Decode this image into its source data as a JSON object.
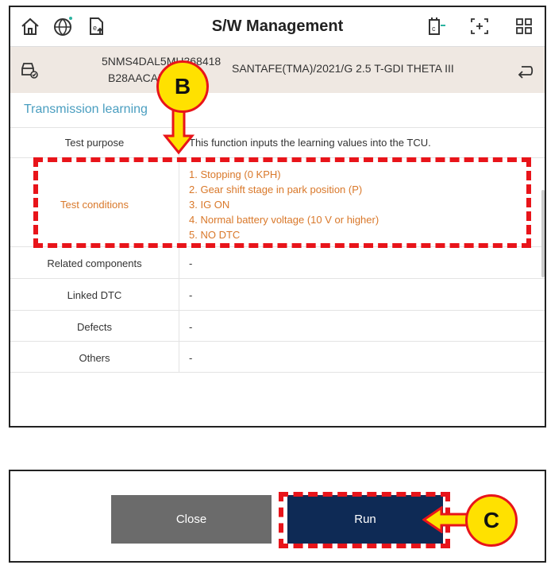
{
  "header": {
    "title": "S/W Management",
    "icons": [
      "home-icon",
      "globe-icon",
      "upload-doc-icon",
      "connector-icon",
      "screen-capture-icon",
      "grid-menu-icon"
    ]
  },
  "vehicle": {
    "vin_line1": "5NMS4DAL5MH368418",
    "vin_line2": "B28AACA5     001F",
    "model": "SANTAFE(TMA)/2021/G 2.5 T-GDI THETA III"
  },
  "section_title": "Transmission learning",
  "rows": [
    {
      "label": "Test purpose",
      "value": "This function inputs the learning values into the TCU."
    },
    {
      "label": "Test conditions",
      "values": [
        "1. Stopping (0 KPH)",
        "2. Gear shift stage in park position (P)",
        "3. IG ON",
        "4. Normal battery voltage (10 V or higher)",
        "5. NO DTC"
      ]
    },
    {
      "label": "Related components",
      "value": "-"
    },
    {
      "label": "Linked DTC",
      "value": "-"
    },
    {
      "label": "Defects",
      "value": "-"
    },
    {
      "label": "Others",
      "value": "-"
    }
  ],
  "buttons": {
    "close": "Close",
    "run": "Run"
  },
  "callouts": {
    "b": "B",
    "c": "C"
  },
  "colors": {
    "section_title": "#4a9ec0",
    "conditions": "#d9782a",
    "run_button": "#0e2a55",
    "close_button": "#6b6b6b",
    "highlight": "#e8141a",
    "callout_fill": "#ffe100"
  }
}
